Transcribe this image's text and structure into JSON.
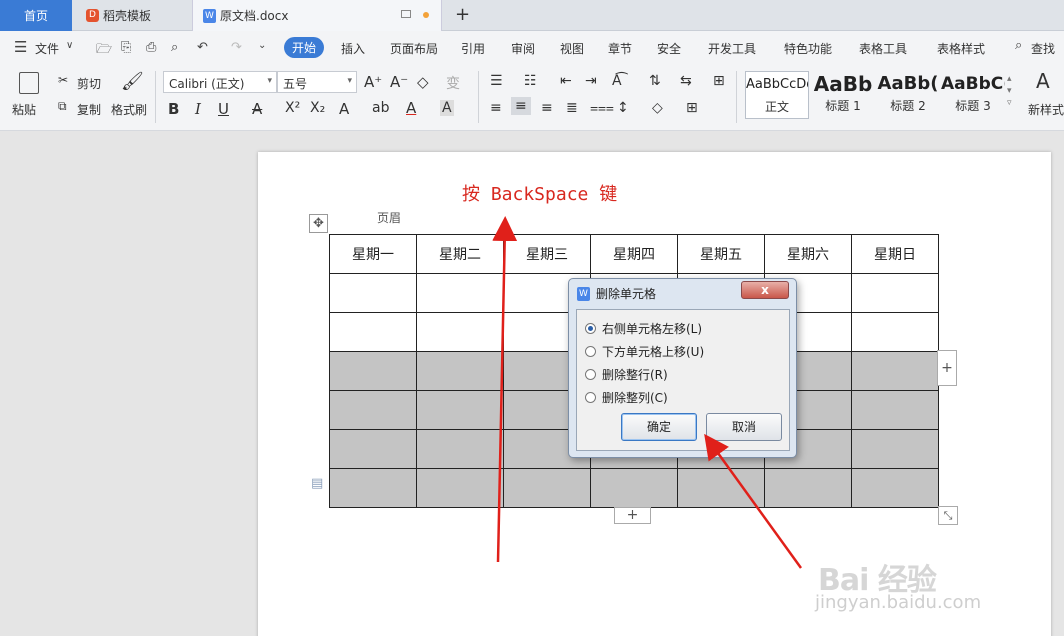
{
  "tabs": {
    "home": "首页",
    "template": "稻壳模板",
    "document": "原文档.docx"
  },
  "menu": [
    "文件",
    "开始",
    "插入",
    "页面布局",
    "引用",
    "审阅",
    "视图",
    "章节",
    "安全",
    "开发工具",
    "特色功能",
    "表格工具",
    "表格样式"
  ],
  "search_label": "查找",
  "ribbon": {
    "paste": "粘贴",
    "cut": "剪切",
    "copy": "复制",
    "format_painter": "格式刷",
    "font_name": "Calibri (正文)",
    "font_size": "五号",
    "styles": [
      {
        "preview": "AaBbCcDd",
        "label": "正文"
      },
      {
        "preview": "AaBb",
        "label": "标题 1"
      },
      {
        "preview": "AaBb(",
        "label": "标题 2"
      },
      {
        "preview": "AaBbC(",
        "label": "标题 3"
      }
    ],
    "new_style": "新样式"
  },
  "annotation": "按 BackSpace 键",
  "header_label": "页眉",
  "table": {
    "headers": [
      "星期一",
      "星期二",
      "星期三",
      "星期四",
      "星期五",
      "星期六",
      "星期日"
    ],
    "blank_rows": 2,
    "gray_rows": 4
  },
  "dialog": {
    "title": "删除单元格",
    "close": "x",
    "options": [
      {
        "label": "右侧单元格左移(L)",
        "selected": true
      },
      {
        "label": "下方单元格上移(U)",
        "selected": false
      },
      {
        "label": "删除整行(R)",
        "selected": false
      },
      {
        "label": "删除整列(C)",
        "selected": false
      }
    ],
    "ok": "确定",
    "cancel": "取消"
  },
  "watermark": {
    "logo": "Bai 经验",
    "url": "jingyan.baidu.com"
  },
  "colors": {
    "accent": "#3a7bd5",
    "annotation": "#d8281f",
    "selection": "#c4c4c4"
  }
}
